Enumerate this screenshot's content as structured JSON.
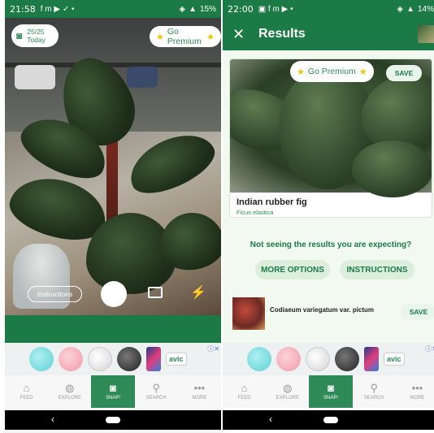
{
  "left": {
    "status": {
      "time": "21:58",
      "icons": "f m ▶ ✓ •",
      "battery": "15%"
    },
    "counter": {
      "count": "25/25",
      "period": "Today"
    },
    "premium": "Go Premium",
    "instructions": "Instructions",
    "nav": [
      {
        "label": "FEED",
        "icon": "home-icon"
      },
      {
        "label": "EXPLORE",
        "icon": "globe-icon"
      },
      {
        "label": "SNAP!",
        "icon": "camera-icon"
      },
      {
        "label": "SEARCH",
        "icon": "search-icon"
      },
      {
        "label": "MORE",
        "icon": "more-icon"
      }
    ],
    "ad_brand": "avic"
  },
  "right": {
    "status": {
      "time": "22:00",
      "icons": "▣ f m ▶ •",
      "battery": "14%"
    },
    "title": "Results",
    "premium": "Go Premium",
    "save": "SAVE",
    "result1": {
      "name": "Indian rubber fig",
      "scientific": "Ficus elastica"
    },
    "question": "Not seeing the results you are expecting?",
    "more_options": "MORE OPTIONS",
    "instructions": "INSTRUCTIONS",
    "result2": {
      "name": "Codiaeum variegatum var. pictum"
    },
    "nav": [
      {
        "label": "FEED",
        "icon": "home-icon"
      },
      {
        "label": "EXPLORE",
        "icon": "globe-icon"
      },
      {
        "label": "SNAP!",
        "icon": "camera-icon"
      },
      {
        "label": "SEARCH",
        "icon": "search-icon"
      },
      {
        "label": "MORE",
        "icon": "more-icon"
      }
    ],
    "ad_brand": "avic"
  },
  "colors": {
    "primary": "#1b7a45",
    "accent": "#2e8b57",
    "star": "#f2c200"
  }
}
